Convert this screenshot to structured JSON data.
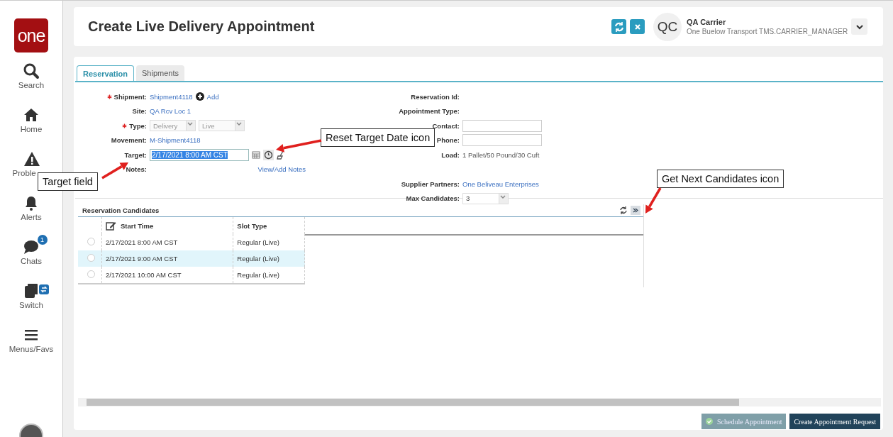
{
  "sidebar": {
    "logo": "one",
    "items": [
      {
        "kind": "search",
        "label": "Search"
      },
      {
        "kind": "home",
        "label": "Home"
      },
      {
        "kind": "problems",
        "label": "Proble"
      },
      {
        "kind": "alerts",
        "label": "Alerts"
      },
      {
        "kind": "chats",
        "label": "Chats",
        "badge": "1"
      },
      {
        "kind": "switch",
        "label": "Switch"
      },
      {
        "kind": "menu",
        "label": "Menus/Favs"
      }
    ]
  },
  "header": {
    "title": "Create Live Delivery Appointment",
    "user": {
      "initials": "QC",
      "name": "QA Carrier",
      "role": "One Buelow Transport TMS.CARRIER_MANAGER"
    }
  },
  "tabs": [
    {
      "label": "Reservation",
      "selected": true
    },
    {
      "label": "Shipments",
      "selected": false
    }
  ],
  "form": {
    "left": [
      {
        "kind": "link",
        "label": "Shipment:",
        "required": true,
        "value": "Shipment4118",
        "action": "Add"
      },
      {
        "kind": "link",
        "label": "Site:",
        "required": false,
        "value": "QA Rcv Loc 1"
      },
      {
        "kind": "selects",
        "label": "Type:",
        "required": true,
        "options": [
          "Delivery",
          "Live"
        ]
      },
      {
        "kind": "link",
        "label": "Movement:",
        "required": false,
        "value": "M-Shipment4118"
      },
      {
        "kind": "datetime",
        "label": "Target:",
        "required": false,
        "value": "2/17/2021 8:00 AM CST"
      },
      {
        "kind": "notes",
        "label": "Notes:",
        "required": false,
        "value": "View/Add Notes"
      }
    ],
    "right": [
      {
        "kind": "text",
        "label": "Reservation Id:"
      },
      {
        "kind": "text",
        "label": "Appointment Type:"
      },
      {
        "kind": "input",
        "label": "Contact:"
      },
      {
        "kind": "input",
        "label": "Phone:"
      },
      {
        "kind": "text",
        "label": "Load:",
        "value": "1 Pallet/50 Pound/30 Cuft"
      },
      {
        "kind": "link",
        "label": "Supplier Partners:",
        "value": "One Beliveau Enterprises"
      },
      {
        "kind": "select",
        "label": "Max Candidates:",
        "value": "3"
      }
    ]
  },
  "candidates": {
    "title": "Reservation Candidates",
    "columns": [
      "Start Time",
      "Slot Type"
    ],
    "rows": [
      {
        "start_time": "2/17/2021 8:00 AM CST",
        "slot_type": "Regular (Live)",
        "checked": false,
        "highlighted": false
      },
      {
        "start_time": "2/17/2021 9:00 AM CST",
        "slot_type": "Regular (Live)",
        "checked": false,
        "highlighted": true
      },
      {
        "start_time": "2/17/2021 10:00 AM CST",
        "slot_type": "Regular (Live)",
        "checked": false,
        "highlighted": false
      }
    ]
  },
  "buttons": [
    {
      "label": "Schedule Appointment",
      "disabled": true
    },
    {
      "label": "Create Appointment Request",
      "disabled": false
    }
  ],
  "callouts": [
    {
      "kind": "target",
      "text": "Target field"
    },
    {
      "kind": "reset",
      "text": "Reset Target Date icon"
    },
    {
      "kind": "next",
      "text": "Get Next Candidates icon"
    }
  ]
}
